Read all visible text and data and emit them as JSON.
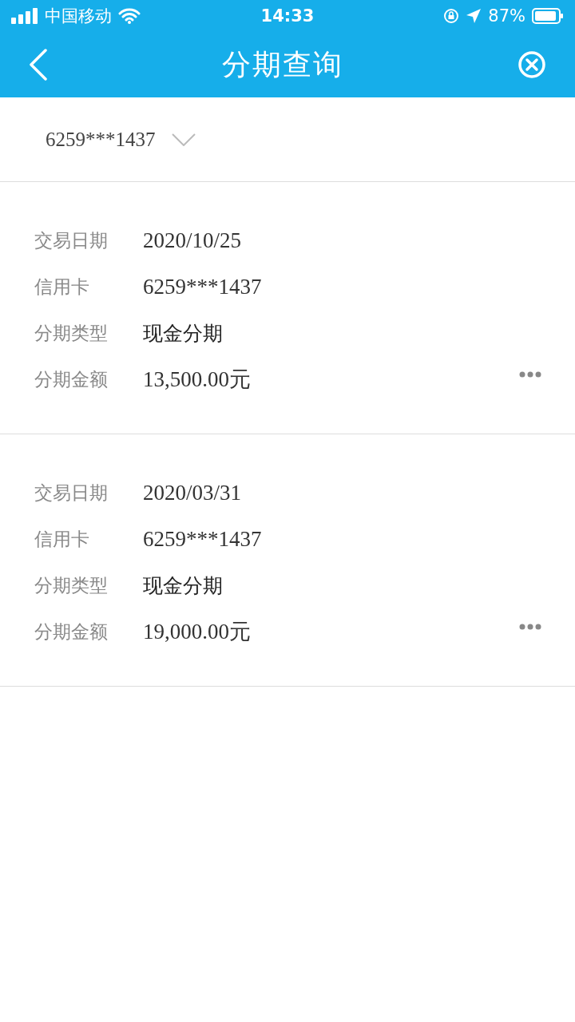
{
  "status_bar": {
    "carrier": "中国移动",
    "time": "14:33",
    "battery": "87%"
  },
  "header": {
    "title": "分期查询"
  },
  "card_select": {
    "value": "6259***1437"
  },
  "records": [
    {
      "fields": [
        {
          "label": "交易日期",
          "value": "2020/10/25"
        },
        {
          "label": "信用卡",
          "value": "6259***1437"
        },
        {
          "label": "分期类型",
          "value": "现金分期",
          "kind": "text"
        },
        {
          "label": "分期金额",
          "value": "13,500.00元"
        }
      ]
    },
    {
      "fields": [
        {
          "label": "交易日期",
          "value": "2020/03/31"
        },
        {
          "label": "信用卡",
          "value": "6259***1437"
        },
        {
          "label": "分期类型",
          "value": "现金分期",
          "kind": "text"
        },
        {
          "label": "分期金额",
          "value": "19,000.00元"
        }
      ]
    }
  ]
}
